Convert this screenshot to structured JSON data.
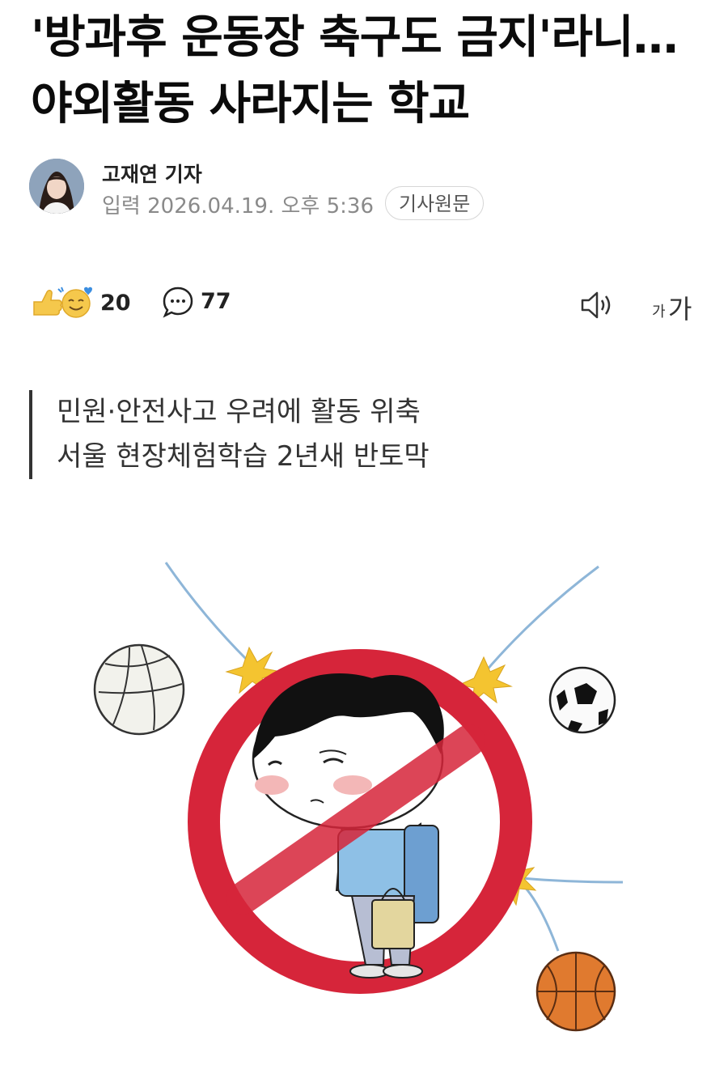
{
  "article": {
    "title": "'방과후 운동장 축구도 금지'라니…야외활동 사라지는 학교",
    "author": "고재연 기자",
    "published": "입력 2026.04.19. 오후 5:36",
    "original_button": "기사원문",
    "subtitle_lines": [
      "민원·안전사고 우려에 활동 위축",
      "서울 현장체험학습 2년새 반토막"
    ]
  },
  "actions": {
    "reactions_count": "20",
    "comments_count": "77",
    "font_small": "가",
    "font_big": "가",
    "icons": [
      "like-emoji-icon",
      "comment-icon",
      "speaker-icon",
      "font-size-icon"
    ]
  },
  "colors": {
    "prohibition_red": "#d6253a",
    "emoji_yellow": "#f5c84c",
    "text_primary": "#111111",
    "text_meta": "#8a8a8a"
  }
}
